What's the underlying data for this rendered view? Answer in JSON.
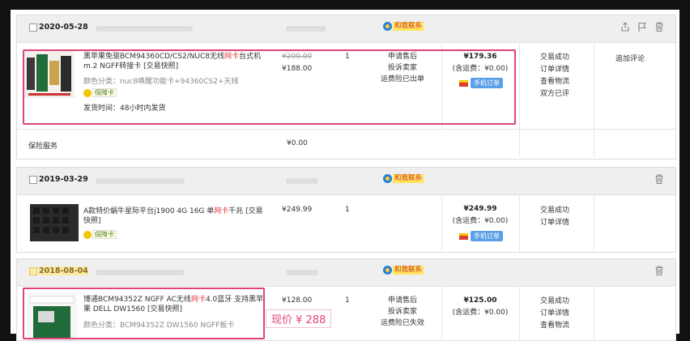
{
  "orders": [
    {
      "date": "2020-05-28",
      "contact_label": "和我联系",
      "icons": [
        "share-icon",
        "flag-icon",
        "trash-icon"
      ],
      "item": {
        "title_pre": "黑苹果免驱BCM94360CD/CS2/NUC8无线",
        "title_red": "网卡",
        "title_post": "台式机m.2 NGFF转接卡 [交易快照]",
        "color_class": "颜色分类：nuc8唤醒功能卡+94360CS2+天线",
        "badge": "保障卡",
        "ship": "发货时间：48小时内发货",
        "orig_price": "¥200.00",
        "price": "¥188.00",
        "qty": "1",
        "services": [
          "申请售后",
          "投诉卖家",
          "运费险已出单"
        ],
        "total": "¥179.36",
        "shipping": "(含运费：¥0.00)",
        "mobile_label": "手机订单",
        "statuses": [
          "交易成功",
          "订单详情",
          "查看物流",
          "双方已评"
        ],
        "action": "追加评论"
      },
      "service_row": {
        "label": "保险服务",
        "price": "¥0.00"
      }
    },
    {
      "date": "2019-03-29",
      "contact_label": "和我联系",
      "icons": [
        "trash-icon"
      ],
      "item": {
        "title_pre": "A款特价蜗牛星际平台j1900 4G 16G 单",
        "title_red": "网卡",
        "title_post": "千兆 [交易快照]",
        "badge": "保障卡",
        "price": "¥249.99",
        "qty": "1",
        "total": "¥249.99",
        "shipping": "(含运费：¥0.00)",
        "mobile_label": "手机订单",
        "statuses": [
          "交易成功",
          "订单详情"
        ]
      }
    },
    {
      "date": "2018-08-04",
      "contact_label": "和我联系",
      "icons": [
        "trash-icon"
      ],
      "item": {
        "title_pre": "博通BCM94352Z NGFF AC无线",
        "title_red": "网卡",
        "title_post": "4.0蓝牙 支持黑苹果 DELL DW1560 [交易快照]",
        "color_class": "颜色分类：BCM94352Z DW1560 NGFF板卡",
        "price": "¥128.00",
        "qty": "1",
        "services": [
          "申请售后",
          "投诉卖家",
          "运费险已失效"
        ],
        "total": "¥125.00",
        "shipping": "(含运费：¥0.00)",
        "statuses": [
          "交易成功",
          "订单详情",
          "查看物流"
        ],
        "price_now": "现价 ¥ 288"
      }
    }
  ],
  "colors": {
    "highlight": "#e0437a",
    "red": "#e4393c",
    "header_bg": "#efefef"
  }
}
